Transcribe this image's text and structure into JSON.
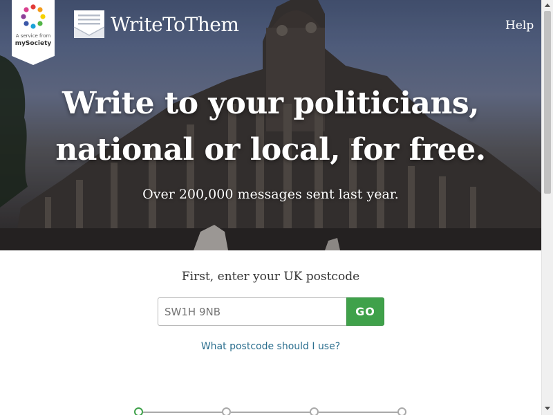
{
  "header": {
    "badge_small": "A service from",
    "badge_brand": "mySociety",
    "logo_text": "WriteToThem",
    "logo_icon": "envelope-icon",
    "help_label": "Help"
  },
  "hero": {
    "headline_line1": "Write to your politicians,",
    "headline_line2": "national or local, for free.",
    "subline": "Over 200,000 messages sent last year."
  },
  "search": {
    "prompt": "First, enter your UK postcode",
    "placeholder": "SW1H 9NB",
    "value": "",
    "go_label": "GO",
    "help_link": "What postcode should I use?"
  },
  "steps": {
    "total": 4,
    "active": 1
  },
  "colors": {
    "accent_green": "#3fa14a",
    "link_blue": "#2a6e8e",
    "badge_dots": [
      "#e23c39",
      "#f39c1d",
      "#f6d200",
      "#53b548",
      "#1aa2d8",
      "#3a57a8",
      "#8b3f98",
      "#d9408f"
    ]
  }
}
